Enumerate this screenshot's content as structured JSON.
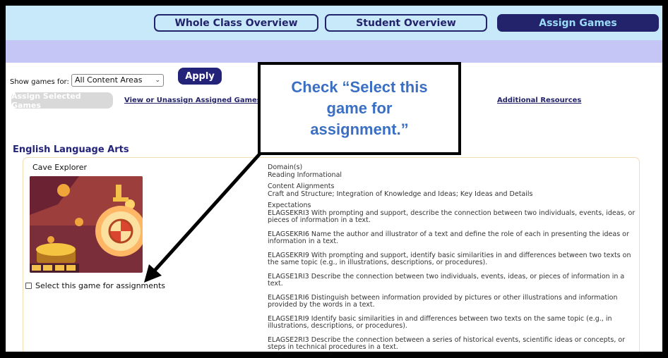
{
  "nav": {
    "tabs": [
      {
        "label": "Whole Class Overview",
        "active": false
      },
      {
        "label": "Student Overview",
        "active": false
      },
      {
        "label": "Assign Games",
        "active": true
      }
    ]
  },
  "filter": {
    "label": "Show games for:",
    "selected": "All Content Areas",
    "apply_label": "Apply"
  },
  "actions": {
    "assign_selected_label": "Assign Selected Games",
    "view_unassign_label": "View or Unassign Assigned Games",
    "additional_resources_label": "Additional Resources"
  },
  "section": {
    "title": "English Language Arts"
  },
  "game": {
    "title": "Cave Explorer",
    "thumb_icon": "cave-explorer-thumbnail",
    "select_label": "Select this game for assignments",
    "domain_head": "Domain(s)",
    "domain": "Reading Informational",
    "alignments_head": "Content Alignments",
    "alignments": "Craft and Structure; Integration of Knowledge and Ideas; Key Ideas and Details",
    "expectations_head": "Expectations",
    "expectations": [
      "ELAGSEKRI3 With prompting and support, describe the connection between two individuals, events, ideas, or pieces of information in a text.",
      "ELAGSEKRI6 Name the author and illustrator of a text and define the role of each in presenting the ideas or information in a text.",
      "ELAGSEKRI9 With prompting and support, identify basic similarities in and differences between two texts on the same topic (e.g., in illustrations, descriptions, or procedures).",
      "ELAGSE1RI3 Describe the connection between two individuals, events, ideas, or pieces of information in a text.",
      "ELAGSE1RI6 Distinguish between information provided by pictures or other illustrations and information provided by the words in a text.",
      "ELAGSE1RI9 Identify basic similarities in and differences between two texts on the same topic (e.g., in illustrations, descriptions, or procedures).",
      "ELAGSE2RI3 Describe the connection between a series of historical events, scientific ideas or concepts, or steps in technical procedures in a text."
    ]
  },
  "callout": {
    "text": "Check “Select this game for assignment.”",
    "color": "#3a6fc4"
  },
  "colors": {
    "navy": "#23236b",
    "topbar": "#c8e9fa",
    "purplebar": "#c5c5f6"
  }
}
